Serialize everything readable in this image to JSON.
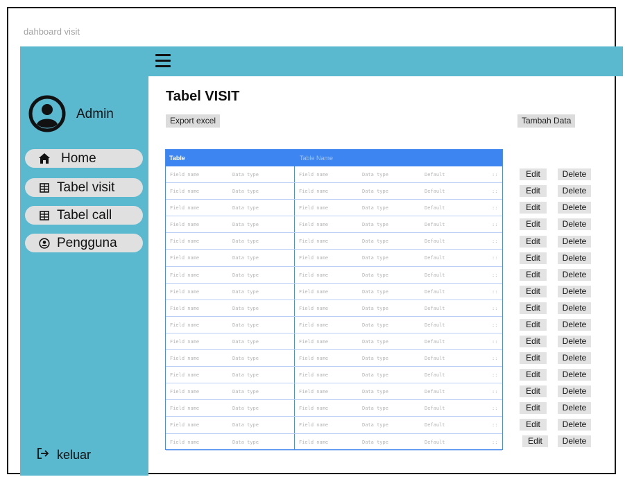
{
  "app_title": "dahboard visit",
  "sidebar": {
    "user_label": "Admin",
    "items": [
      {
        "label": "Home",
        "icon": "home-icon"
      },
      {
        "label": "Tabel visit",
        "icon": "table-icon"
      },
      {
        "label": "Tabel call",
        "icon": "table-icon"
      },
      {
        "label": "Pengguna",
        "icon": "user-circle-icon"
      }
    ],
    "logout_label": "keluar"
  },
  "main": {
    "title": "Tabel VISIT",
    "export_label": "Export excel",
    "add_label": "Tambah Data",
    "table": {
      "header_left": "Table",
      "header_right": "Table Name",
      "row_cells": [
        "Field name",
        "Data type",
        "Field name",
        "Data type",
        "Default",
        "::"
      ],
      "row_count": 17
    },
    "edit_label": "Edit",
    "delete_label": "Delete"
  },
  "colors": {
    "sidebar": "#5ab8cf",
    "table_header": "#3d85f0",
    "button": "#dcdcdc"
  }
}
